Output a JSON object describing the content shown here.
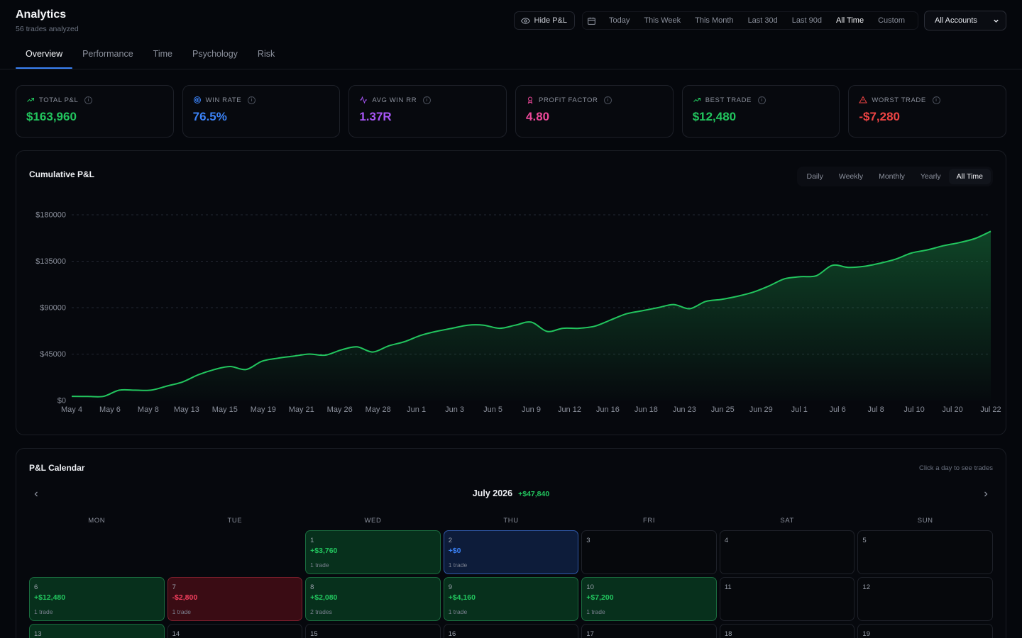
{
  "header": {
    "title": "Analytics",
    "subtitle": "56 trades analyzed"
  },
  "toolbar": {
    "hide_pnl_label": "Hide P&L",
    "ranges": [
      "Today",
      "This Week",
      "This Month",
      "Last 30d",
      "Last 90d",
      "All Time",
      "Custom"
    ],
    "active_range": "All Time",
    "account_select": "All Accounts"
  },
  "tabs": {
    "items": [
      "Overview",
      "Performance",
      "Time",
      "Psychology",
      "Risk"
    ],
    "active": "Overview"
  },
  "stats": [
    {
      "label": "TOTAL P&L",
      "value": "$163,960",
      "color": "#22c55e",
      "icon": "trending-up-icon"
    },
    {
      "label": "WIN RATE",
      "value": "76.5%",
      "color": "#3b82f6",
      "icon": "target-icon"
    },
    {
      "label": "AVG WIN RR",
      "value": "1.37R",
      "color": "#a855f7",
      "icon": "activity-icon"
    },
    {
      "label": "PROFIT FACTOR",
      "value": "4.80",
      "color": "#ec4899",
      "icon": "award-icon"
    },
    {
      "label": "BEST TRADE",
      "value": "$12,480",
      "color": "#22c55e",
      "icon": "trending-up-icon"
    },
    {
      "label": "WORST TRADE",
      "value": "-$7,280",
      "color": "#ef4444",
      "icon": "alert-triangle-icon"
    }
  ],
  "cumulative": {
    "title": "Cumulative P&L",
    "periods": [
      "Daily",
      "Weekly",
      "Monthly",
      "Yearly",
      "All Time"
    ],
    "active_period": "All Time"
  },
  "chart_data": {
    "type": "area",
    "title": "Cumulative P&L",
    "xlabel": "",
    "ylabel": "",
    "y_ticks": [
      "$0",
      "$45000",
      "$90000",
      "$135000",
      "$180000"
    ],
    "ylim": [
      0,
      180000
    ],
    "x_ticks": [
      "May 4",
      "May 6",
      "May 8",
      "May 13",
      "May 15",
      "May 19",
      "May 21",
      "May 26",
      "May 28",
      "Jun 1",
      "Jun 3",
      "Jun 5",
      "Jun 9",
      "Jun 12",
      "Jun 16",
      "Jun 18",
      "Jun 23",
      "Jun 25",
      "Jun 29",
      "Jul 1",
      "Jul 6",
      "Jul 8",
      "Jul 10",
      "Jul 20",
      "Jul 22"
    ],
    "grid": true,
    "series": [
      {
        "color": "#22c55e",
        "values": [
          4000,
          4000,
          4000,
          10000,
          10000,
          10000,
          14000,
          18000,
          25000,
          30000,
          33000,
          30000,
          38000,
          41000,
          43000,
          45000,
          44000,
          49000,
          52000,
          47000,
          53000,
          57000,
          63000,
          67000,
          70000,
          73000,
          73000,
          70000,
          73000,
          76000,
          67000,
          70000,
          70000,
          72000,
          78000,
          84000,
          87000,
          90000,
          93000,
          89000,
          96000,
          98000,
          101000,
          105000,
          111000,
          118000,
          120000,
          121000,
          131000,
          129000,
          130000,
          133000,
          137000,
          143000,
          146000,
          150000,
          153000,
          157000,
          164000
        ]
      }
    ]
  },
  "calendar": {
    "title": "P&L Calendar",
    "hint": "Click a day to see trades",
    "month": "July 2026",
    "month_total": "+$47,840",
    "weekdays": [
      "MON",
      "TUE",
      "WED",
      "THU",
      "FRI",
      "SAT",
      "SUN"
    ],
    "leading_blanks": 2,
    "days": [
      {
        "num": "1",
        "pnl": "+$3,760",
        "trades": "1 trade",
        "status": "win"
      },
      {
        "num": "2",
        "pnl": "+$0",
        "trades": "1 trade",
        "status": "flat"
      },
      {
        "num": "3",
        "pnl": "",
        "trades": "",
        "status": "none"
      },
      {
        "num": "4",
        "pnl": "",
        "trades": "",
        "status": "none"
      },
      {
        "num": "5",
        "pnl": "",
        "trades": "",
        "status": "none"
      },
      {
        "num": "6",
        "pnl": "+$12,480",
        "trades": "1 trade",
        "status": "win"
      },
      {
        "num": "7",
        "pnl": "-$2,800",
        "trades": "1 trade",
        "status": "loss"
      },
      {
        "num": "8",
        "pnl": "+$2,080",
        "trades": "2 trades",
        "status": "win"
      },
      {
        "num": "9",
        "pnl": "+$4,160",
        "trades": "1 trade",
        "status": "win"
      },
      {
        "num": "10",
        "pnl": "+$7,200",
        "trades": "1 trade",
        "status": "win"
      },
      {
        "num": "11",
        "pnl": "",
        "trades": "",
        "status": "none"
      },
      {
        "num": "12",
        "pnl": "",
        "trades": "",
        "status": "none"
      },
      {
        "num": "13",
        "pnl": "",
        "trades": "",
        "status": "win"
      },
      {
        "num": "14",
        "pnl": "",
        "trades": "",
        "status": "none"
      },
      {
        "num": "15",
        "pnl": "",
        "trades": "",
        "status": "none"
      },
      {
        "num": "16",
        "pnl": "",
        "trades": "",
        "status": "none"
      },
      {
        "num": "17",
        "pnl": "",
        "trades": "",
        "status": "none"
      },
      {
        "num": "18",
        "pnl": "",
        "trades": "",
        "status": "none"
      },
      {
        "num": "19",
        "pnl": "",
        "trades": "",
        "status": "none"
      }
    ]
  }
}
